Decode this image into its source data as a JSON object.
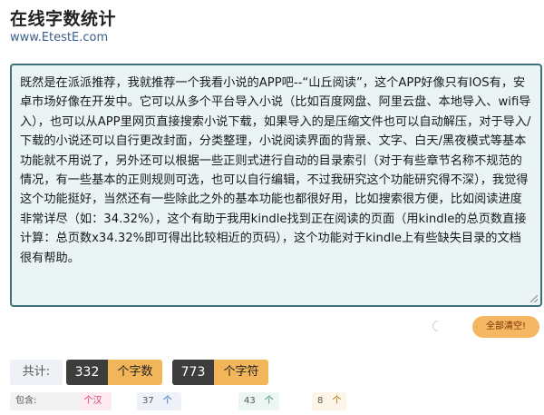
{
  "header": {
    "title": "在线字数统计",
    "subtitle": "www.EtestE.com"
  },
  "editor": {
    "text": "既然是在派派推荐，我就推荐一个我看小说的APP吧--“山丘阅读”，这个APP好像只有IOS有，安卓市场好像在开发中。它可以从多个平台导入小说（比如百度网盘、阿里云盘、本地导入、wifi导入），也可以从APP里网页直接搜索小说下载，如果导入的是压缩文件也可以自动解压，对于导入/下载的小说还可以自行更改封面，分类整理，小说阅读界面的背景、文字、白天/黑夜模式等基本功能就不用说了，另外还可以根据一些正则式进行自动的目录索引（对于有些章节名称不规范的情况，有一些基本的正则规则可选，也可以自行编辑，不过我研究这个功能研究得不深），我觉得这个功能挺好，当然还有一些除此之外的基本功能也都很好用，比如搜索很方便，比如阅读进度非常详尽（如：34.32%），这个有助于我用kindle找到正在阅读的页面（用kindle的总页数直接计算：总页数x34.32%即可得出比较相近的页码），这个功能对于kindle上有些缺失目录的文档很有帮助。"
  },
  "actions": {
    "clear_label": "全部清空!"
  },
  "totals": {
    "label": "共计:",
    "char_count": "332",
    "char_unit": "个字数",
    "byte_count": "773",
    "byte_unit": "个字符"
  },
  "details": {
    "label": "包含:",
    "chinese_count": "324",
    "chinese_unit": "个汉字",
    "punct_count": "37",
    "punct_unit": "个标点(全角)",
    "letter_count": "43",
    "letter_unit": "个字母",
    "digit_count": "8",
    "digit_unit": "个数字"
  },
  "colors": {
    "accent": "#f2b65a",
    "editor_border": "#3f6f7a",
    "editor_bg": "#eaf4f4",
    "dark_pill": "#3d3d3d"
  }
}
